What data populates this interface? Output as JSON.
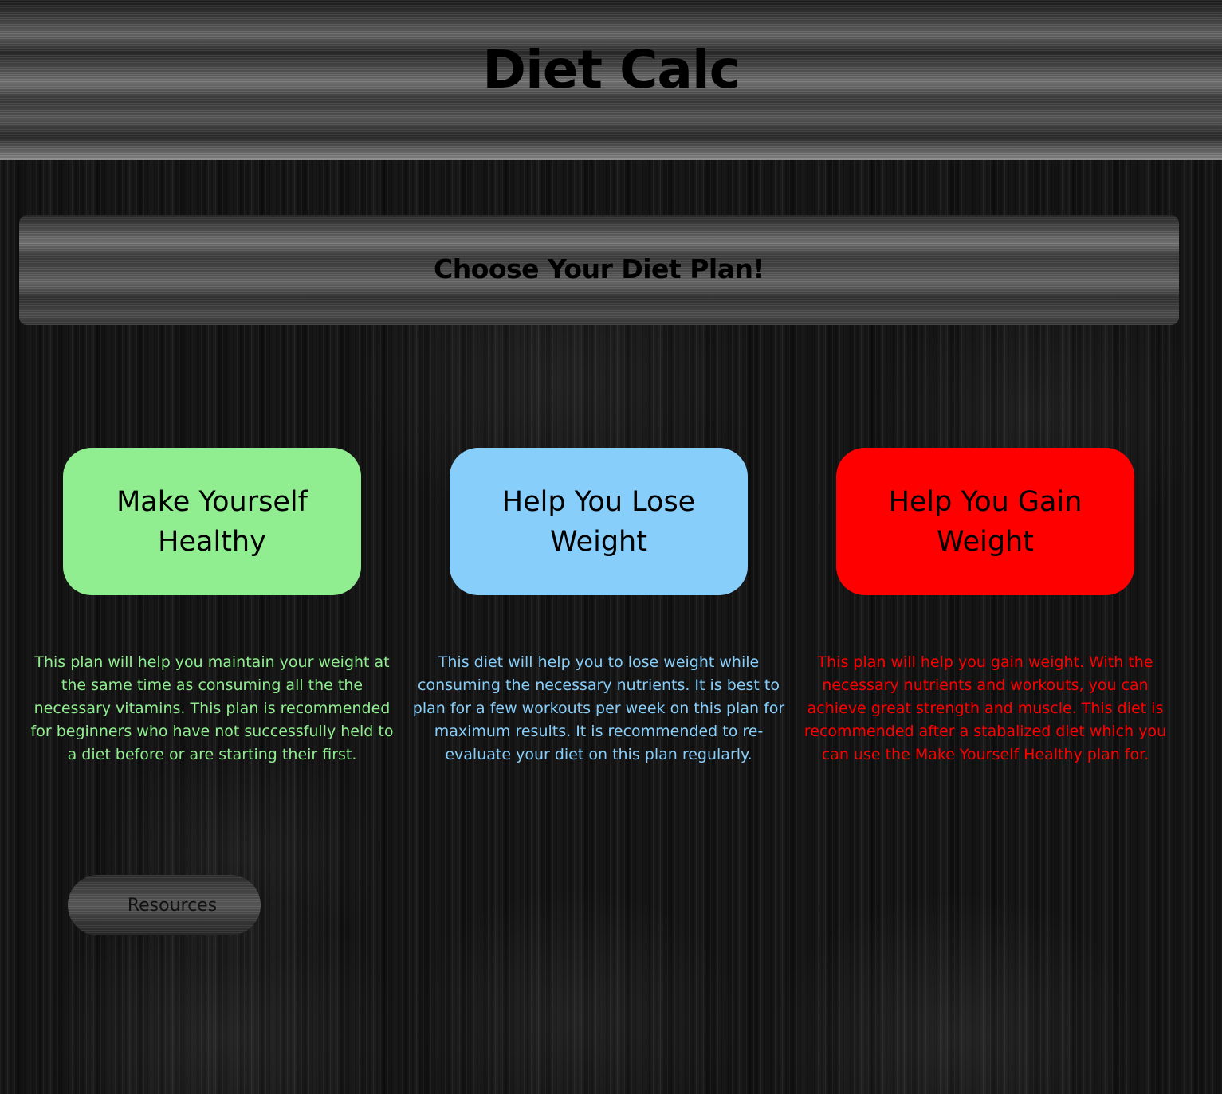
{
  "header": {
    "title": "Diet Calc"
  },
  "banner": {
    "title": "Choose Your Diet Plan!"
  },
  "colors": {
    "healthy": "#90ee90",
    "lose": "#87cefa",
    "gain": "#ff0000"
  },
  "plans": [
    {
      "label": "Make Yourself Healthy",
      "description": "This plan will help you maintain your weight at the same time as consuming all the the necessary vitamins. This plan is recommended for beginners who have not successfully held to a diet before or are starting their first."
    },
    {
      "label": "Help You Lose Weight",
      "description": "This diet will help you to lose weight while consuming the necessary nutrients. It is best to plan for a few workouts per week on this plan for maximum results. It is recommended to re-evaluate your diet on this plan regularly."
    },
    {
      "label": "Help You Gain Weight",
      "description": "This plan will help you gain weight. With the necessary nutrients and workouts, you can achieve great strength and muscle. This diet is recommended after a stabalized diet which you can use the Make Yourself Healthy plan for."
    }
  ],
  "resources": {
    "label": "Resources"
  }
}
